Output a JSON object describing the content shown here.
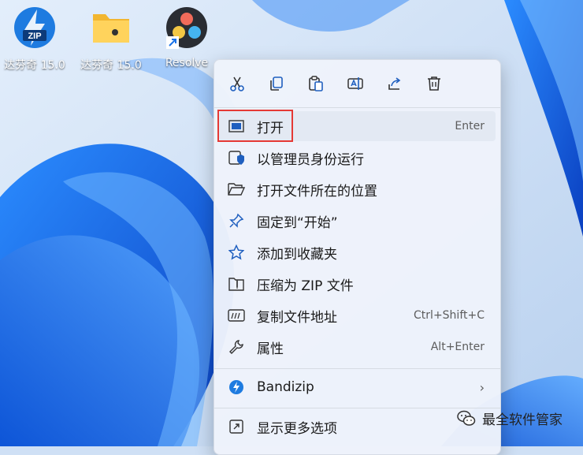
{
  "desktop": {
    "icons": [
      {
        "label": "达芬奇 15.0",
        "icon": "bandizip-zip-icon"
      },
      {
        "label": "达芬奇 15.0",
        "icon": "folder-icon"
      },
      {
        "label": "Resolve",
        "icon": "davinci-resolve-icon"
      }
    ],
    "zip_badge": "ZIP"
  },
  "context_menu": {
    "toolbar": [
      "cut-icon",
      "copy-icon",
      "paste-icon",
      "rename-icon",
      "share-icon",
      "delete-icon"
    ],
    "items": [
      {
        "label": "打开",
        "shortcut": "Enter",
        "icon": "open-icon"
      },
      {
        "label": "以管理员身份运行",
        "shortcut": "",
        "icon": "shield-icon"
      },
      {
        "label": "打开文件所在的位置",
        "shortcut": "",
        "icon": "folder-open-icon"
      },
      {
        "label": "固定到“开始”",
        "shortcut": "",
        "icon": "pin-icon"
      },
      {
        "label": "添加到收藏夹",
        "shortcut": "",
        "icon": "star-icon"
      },
      {
        "label": "压缩为 ZIP 文件",
        "shortcut": "",
        "icon": "zip-folder-icon"
      },
      {
        "label": "复制文件地址",
        "shortcut": "Ctrl+Shift+C",
        "icon": "copy-path-icon"
      },
      {
        "label": "属性",
        "shortcut": "Alt+Enter",
        "icon": "wrench-icon"
      },
      {
        "label": "Bandizip",
        "shortcut": "",
        "icon": "bandizip-icon"
      },
      {
        "label": "显示更多选项",
        "shortcut": "",
        "icon": "more-options-icon"
      }
    ]
  },
  "watermark": {
    "text": "最全软件管家",
    "icon": "wechat-icon"
  },
  "colors": {
    "accent": "#0a64d8",
    "highlight_border": "#e53935",
    "menu_bg": "#eef3fb"
  }
}
